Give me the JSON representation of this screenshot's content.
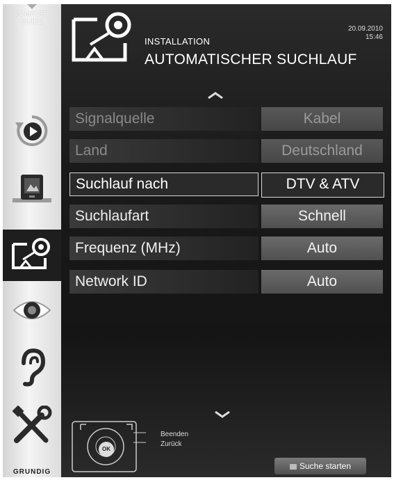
{
  "sidebar": {
    "comfort_line1": "COMFORT",
    "comfort_line2": "GUIDE",
    "items": [
      {
        "icon": "source-icon",
        "active": false
      },
      {
        "icon": "picture-icon",
        "active": false
      },
      {
        "icon": "installation-icon",
        "active": true
      },
      {
        "icon": "eye-icon",
        "active": false
      },
      {
        "icon": "ear-icon",
        "active": false
      },
      {
        "icon": "tools-icon",
        "active": false
      }
    ],
    "brand": "GRUNDIG"
  },
  "header": {
    "section": "INSTALLATION",
    "title": "AUTOMATISCHER SUCHLAUF",
    "date": "20.09.2010",
    "time": "15:46"
  },
  "menu": {
    "rows": [
      {
        "label": "Signalquelle",
        "value": "Kabel",
        "state": "disabled"
      },
      {
        "label": "Land",
        "value": "Deutschland",
        "state": "disabled"
      },
      {
        "label": "Suchlauf nach",
        "value": "DTV & ATV",
        "state": "selected"
      },
      {
        "label": "Suchlaufart",
        "value": "Schnell",
        "state": "normal"
      },
      {
        "label": "Frequenz (MHz)",
        "value": "Auto",
        "state": "normal"
      },
      {
        "label": "Network ID",
        "value": "Auto",
        "state": "normal"
      }
    ]
  },
  "footer": {
    "hint_exit": "Beenden",
    "hint_back": "Zurück",
    "ok_label": "OK",
    "start_button": "Suche starten"
  },
  "colors": {
    "panel_bg": "#1a1a1a",
    "row_label_bg": "#2c2c2c",
    "row_value_bg": "#5a5a5a",
    "selected_border": "#d8d8d8"
  }
}
